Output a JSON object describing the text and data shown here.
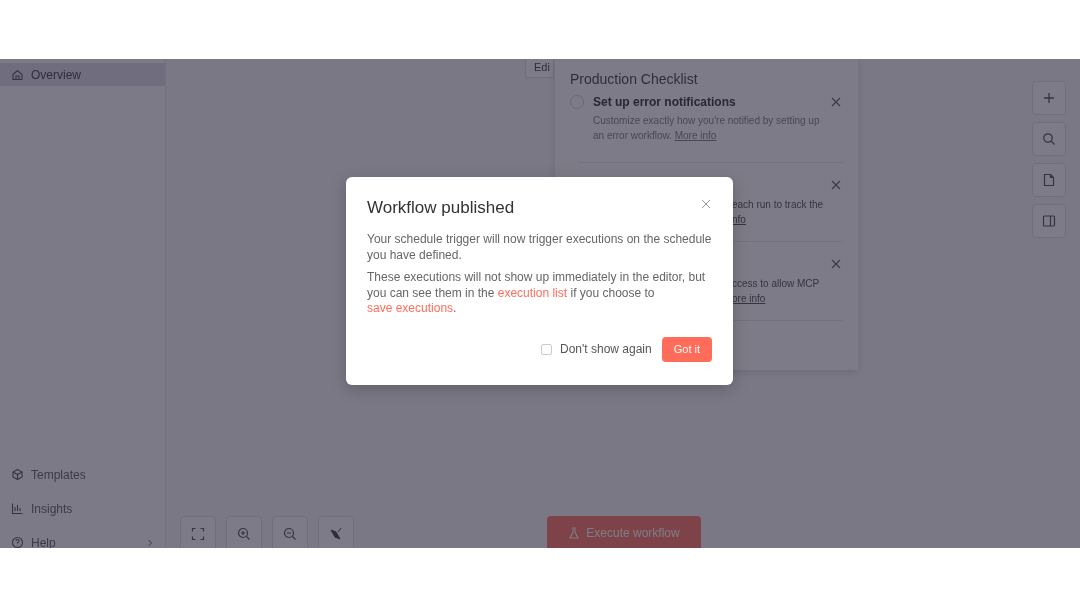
{
  "sidebar": {
    "top_items": [
      {
        "label": "Overview",
        "selected": true
      }
    ],
    "bottom_items": [
      {
        "label": "Templates",
        "expandable": false
      },
      {
        "label": "Insights",
        "expandable": false
      },
      {
        "label": "Help",
        "expandable": true
      }
    ]
  },
  "editor_tab": {
    "label": "Edi"
  },
  "checklist": {
    "title": "Production Checklist",
    "items": [
      {
        "kind": "full",
        "title": "Set up error notifications",
        "checked": false,
        "description": "Customize exactly how you're notified by setting up an error workflow.",
        "link": "More info"
      },
      {
        "kind": "covered",
        "description": "each run to track the",
        "link": "nfo"
      },
      {
        "kind": "covered",
        "description": "ccess to allow MCP",
        "link": "ore info"
      }
    ]
  },
  "canvas": {
    "execute_button": "Execute workflow"
  },
  "dialog": {
    "title": "Workflow published",
    "paragraphs": [
      [
        {
          "kind": "text",
          "text": "Your schedule trigger will now trigger executions on the schedule you have defined."
        }
      ],
      [
        {
          "kind": "text",
          "text": "These executions will not show up immediately in the editor, but you can see them in the "
        },
        {
          "kind": "link",
          "text": "execution list"
        },
        {
          "kind": "text",
          "text": " if you choose to "
        },
        {
          "kind": "link",
          "text": "save executions"
        },
        {
          "kind": "text",
          "text": "."
        }
      ]
    ],
    "checkbox": {
      "label": "Don't show again",
      "checked": false
    },
    "button": "Got it"
  }
}
